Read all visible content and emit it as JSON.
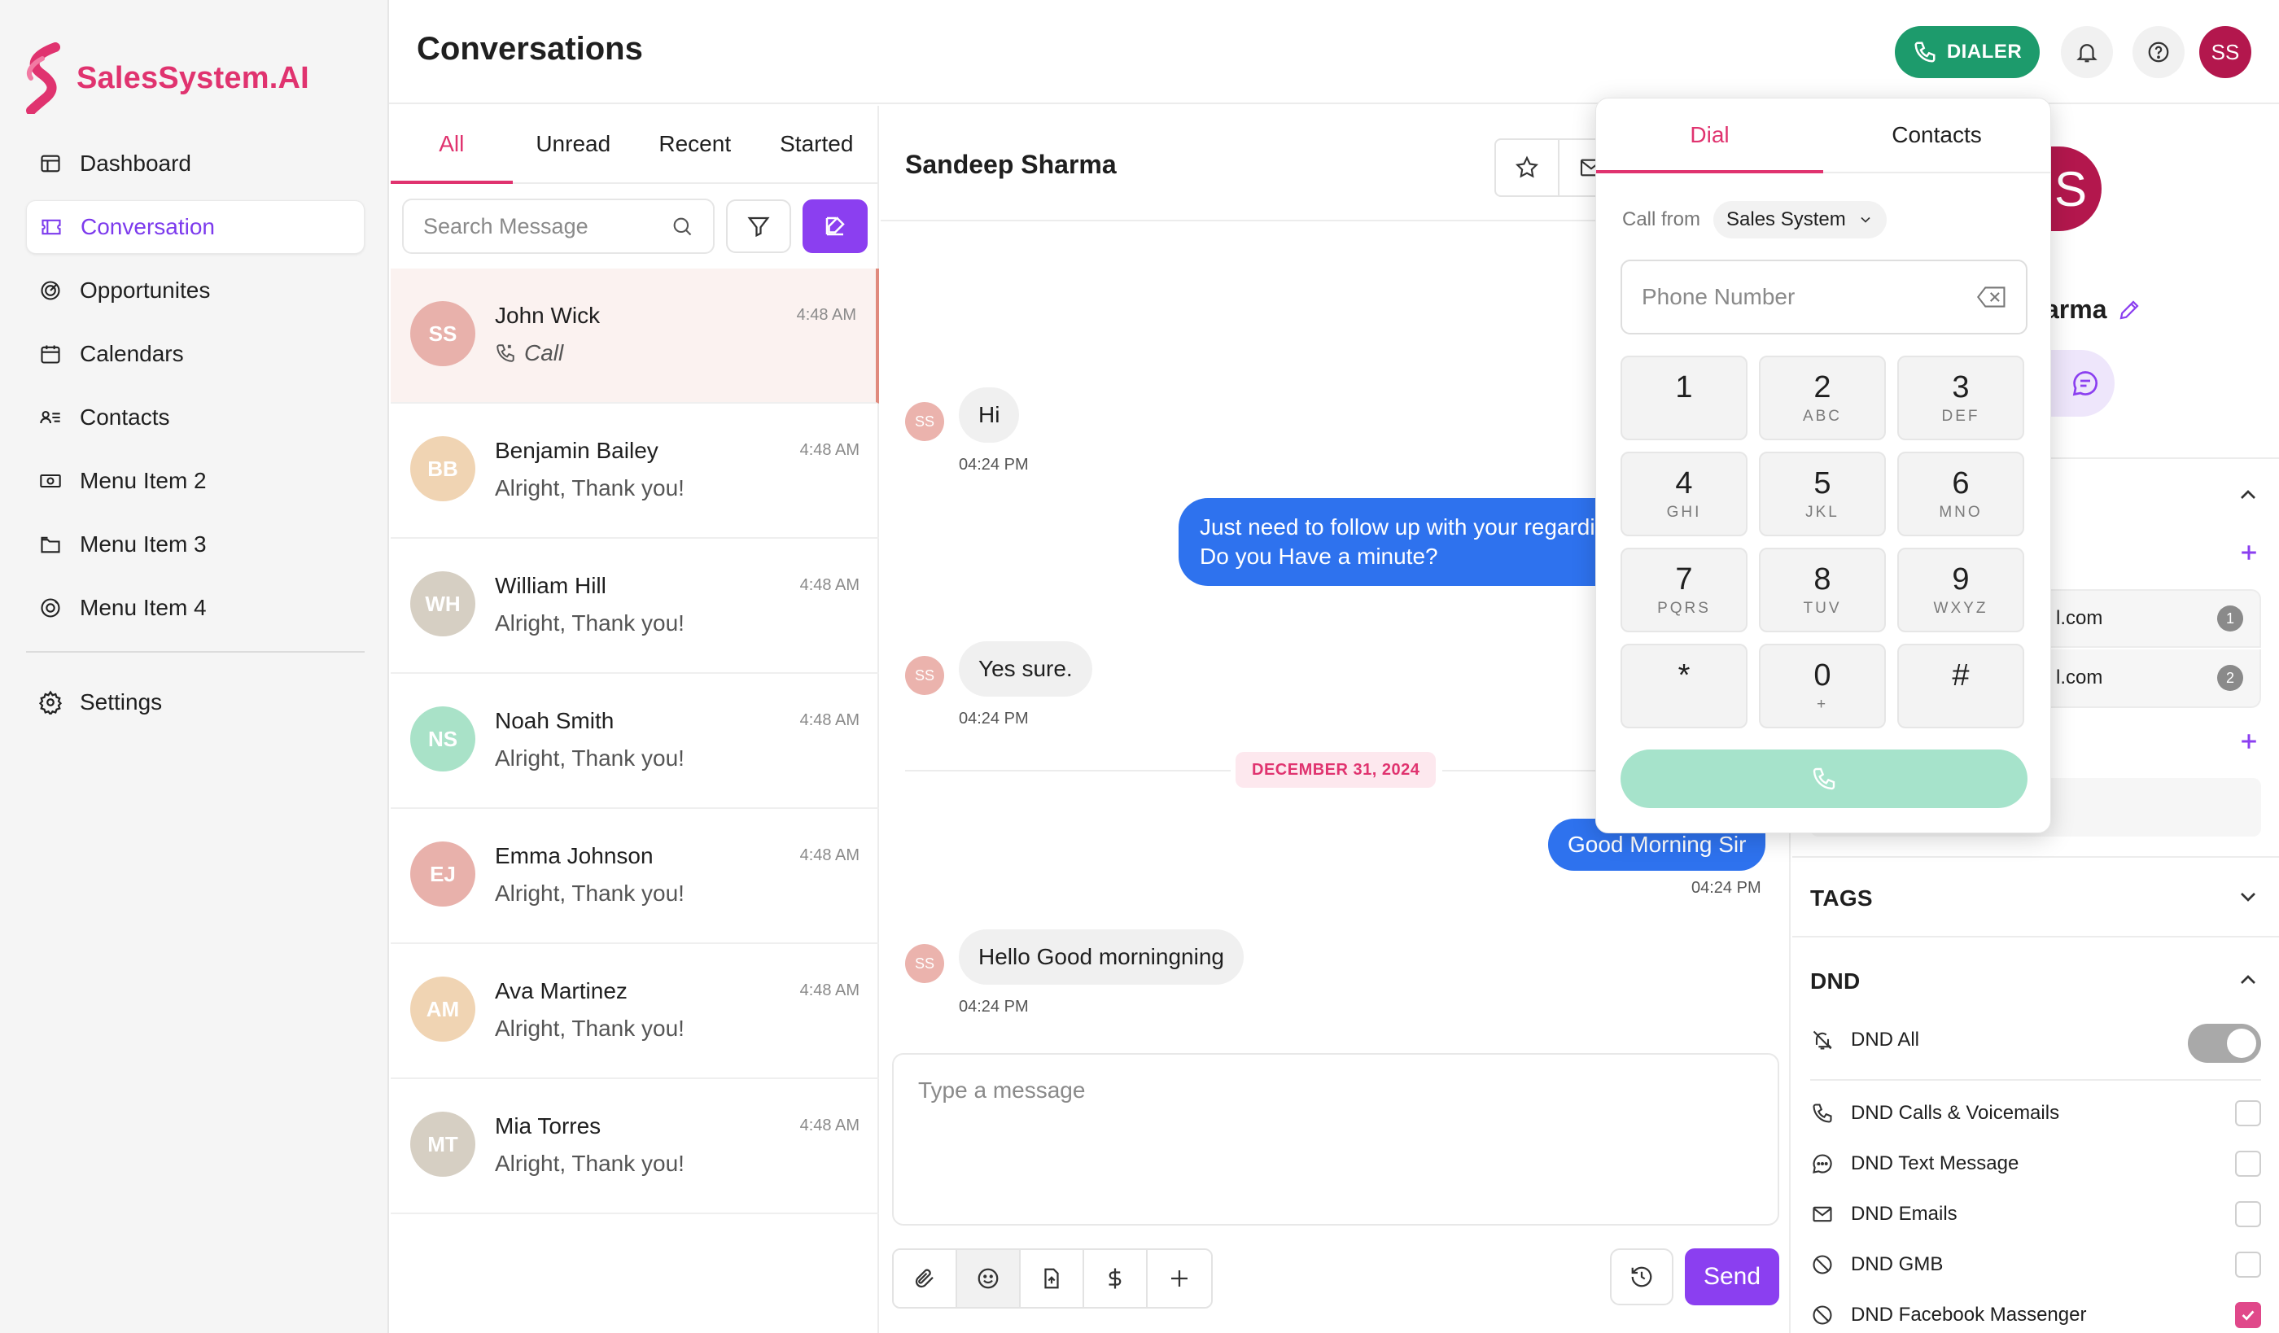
{
  "app": {
    "name": "SalesSystem.AI",
    "brand_color": "#e0336f",
    "accent": "#8b3ff0"
  },
  "sidebar": {
    "items": [
      {
        "label": "Dashboard",
        "icon": "dashboard-icon"
      },
      {
        "label": "Conversation",
        "icon": "conversation-icon",
        "active": true
      },
      {
        "label": "Opportunites",
        "icon": "target-icon"
      },
      {
        "label": "Calendars",
        "icon": "calendar-icon"
      },
      {
        "label": "Contacts",
        "icon": "contacts-icon"
      },
      {
        "label": "Menu Item 2",
        "icon": "money-icon"
      },
      {
        "label": "Menu Item 3",
        "icon": "folder-icon"
      },
      {
        "label": "Menu Item 4",
        "icon": "badge-icon"
      }
    ],
    "settings_label": "Settings"
  },
  "header": {
    "title": "Conversations",
    "dialer_label": "DIALER",
    "user_initials": "SS"
  },
  "list": {
    "tabs": [
      "All",
      "Unread",
      "Recent",
      "Started"
    ],
    "active_tab": "All",
    "search_placeholder": "Search Message",
    "conversations": [
      {
        "initials": "SS",
        "name": "John Wick",
        "preview": "Call",
        "time": "4:48 AM",
        "color": "#e8b1ab",
        "selected": true,
        "is_call": true
      },
      {
        "initials": "BB",
        "name": "Benjamin Bailey",
        "preview": "Alright, Thank you!",
        "time": "4:48 AM",
        "color": "#f0d4b3"
      },
      {
        "initials": "WH",
        "name": "William Hill",
        "preview": "Alright, Thank you!",
        "time": "4:48 AM",
        "color": "#d6cfc3"
      },
      {
        "initials": "NS",
        "name": "Noah Smith",
        "preview": "Alright, Thank you!",
        "time": "4:48 AM",
        "color": "#a9e2c8"
      },
      {
        "initials": "EJ",
        "name": "Emma Johnson",
        "preview": "Alright, Thank you!",
        "time": "4:48 AM",
        "color": "#e8b1ab"
      },
      {
        "initials": "AM",
        "name": "Ava Martinez",
        "preview": "Alright, Thank you!",
        "time": "4:48 AM",
        "color": "#f0d4b3"
      },
      {
        "initials": "MT",
        "name": "Mia Torres",
        "preview": "Alright, Thank you!",
        "time": "4:48 AM",
        "color": "#d6cfc3"
      }
    ]
  },
  "chat": {
    "contact_name": "Sandeep Sharma",
    "sender_initials": "SS",
    "messages": {
      "m1_text": "Hi",
      "m1_time": "04:24 PM",
      "m2_line1": "Just need to follow up with your regardi",
      "m2_line2": "Do you Have a minute?",
      "m3_text": "Yes sure.",
      "m3_time": "04:24 PM",
      "date_divider": "DECEMBER 31, 2024",
      "m4_text": "Good Morning Sir",
      "m4_time": "04:24 PM",
      "m5_text": "Hello Good morningning",
      "m5_time": "04:24 PM"
    },
    "composer_placeholder": "Type a message",
    "send_label": "Send"
  },
  "contact_panel": {
    "avatar_letter": "S",
    "name_partial": "arma",
    "email_1": "l.com",
    "email_1_index": "1",
    "email_2": "l.com",
    "email_2_index": "2",
    "tags_title": "TAGS",
    "dnd_title": "DND",
    "dnd_all_label": "DND All",
    "dnd_items": [
      {
        "label": "DND Calls & Voicemails",
        "icon": "phone-icon",
        "checked": false
      },
      {
        "label": "DND Text Message",
        "icon": "message-icon",
        "checked": false
      },
      {
        "label": "DND Emails",
        "icon": "mail-icon",
        "checked": false
      },
      {
        "label": "DND GMB",
        "icon": "block-icon",
        "checked": false
      },
      {
        "label": "DND Facebook Massenger",
        "icon": "block-icon",
        "checked": true
      }
    ]
  },
  "dialer": {
    "tabs": [
      "Dial",
      "Contacts"
    ],
    "active_tab": "Dial",
    "call_from_label": "Call from",
    "call_from_value": "Sales System",
    "phone_placeholder": "Phone Number",
    "keys": [
      {
        "digit": "1",
        "letters": ""
      },
      {
        "digit": "2",
        "letters": "ABC"
      },
      {
        "digit": "3",
        "letters": "DEF"
      },
      {
        "digit": "4",
        "letters": "GHI"
      },
      {
        "digit": "5",
        "letters": "JKL"
      },
      {
        "digit": "6",
        "letters": "MNO"
      },
      {
        "digit": "7",
        "letters": "PQRS"
      },
      {
        "digit": "8",
        "letters": "TUV"
      },
      {
        "digit": "9",
        "letters": "WXYZ"
      },
      {
        "digit": "*",
        "letters": ""
      },
      {
        "digit": "0",
        "letters": "+"
      },
      {
        "digit": "#",
        "letters": ""
      }
    ],
    "call_button_color": "#a6e3cb"
  }
}
